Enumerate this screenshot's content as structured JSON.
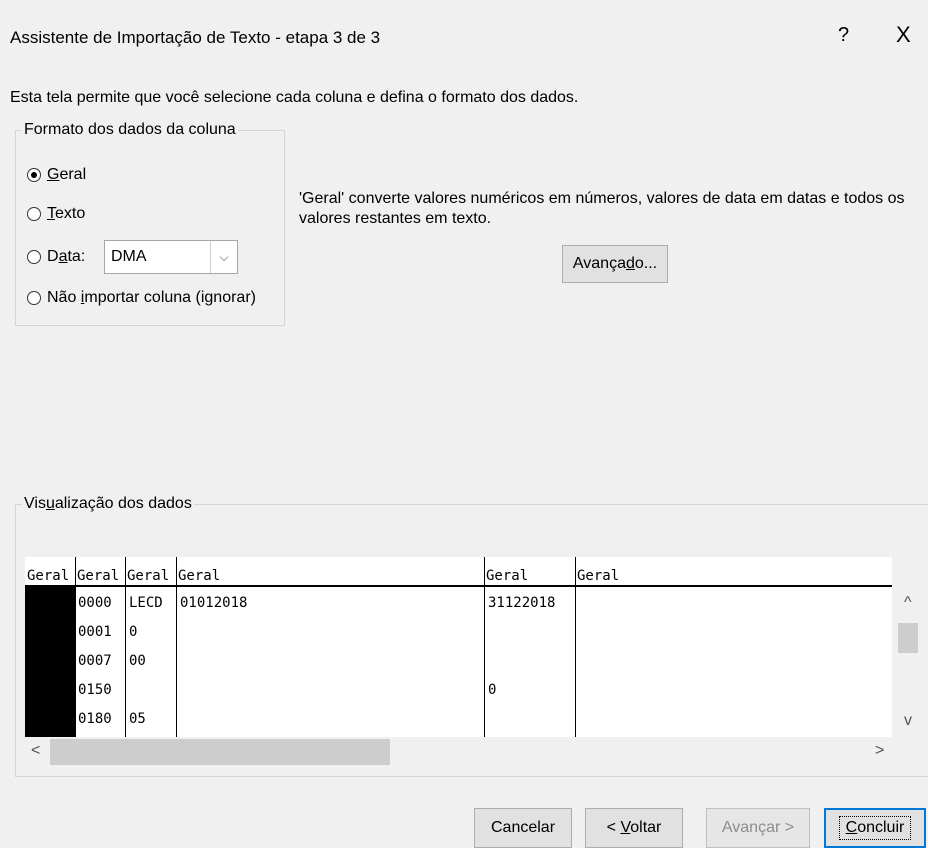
{
  "window": {
    "title": "Assistente de Importação de Texto - etapa 3 de 3",
    "help_icon": "?",
    "close_icon": "X"
  },
  "description": "Esta tela permite que você selecione cada coluna e defina o formato dos dados.",
  "column_format": {
    "legend": "Formato dos dados da coluna",
    "options": [
      {
        "pre": "",
        "u": "G",
        "post": "eral",
        "checked": true
      },
      {
        "pre": "",
        "u": "T",
        "post": "exto",
        "checked": false
      },
      {
        "pre": "D",
        "u": "a",
        "post": "ta:",
        "checked": false
      },
      {
        "pre": "Não ",
        "u": "i",
        "post": "mportar coluna (ignorar)",
        "checked": false
      }
    ],
    "date_select": {
      "value": "DMA",
      "arrow": "⌵"
    }
  },
  "explanation": "'Geral' converte valores numéricos em números, valores de data em datas e todos os valores restantes em texto.",
  "advanced_button": {
    "pre": "Avança",
    "u": "d",
    "post": "o..."
  },
  "preview": {
    "legend_pre": "Vis",
    "legend_u": "u",
    "legend_post": "alização dos dados",
    "headers": [
      "Geral",
      "Geral",
      "Geral",
      "Geral",
      "Geral",
      "Geral"
    ],
    "rows": [
      [
        "",
        "0000",
        "LECD",
        "01012018",
        "31122018",
        ""
      ],
      [
        "",
        "0001",
        "0",
        "",
        "",
        ""
      ],
      [
        "",
        "0007",
        "00",
        "",
        "",
        ""
      ],
      [
        "",
        "0150",
        "",
        "",
        "0",
        ""
      ],
      [
        "",
        "0180",
        "05",
        "",
        "",
        ""
      ]
    ]
  },
  "scroll": {
    "up": "^",
    "down": "v",
    "left": "<",
    "right": ">"
  },
  "buttons": {
    "cancel": "Cancelar",
    "back": {
      "pre": "< ",
      "u": "V",
      "post": "oltar"
    },
    "next": "Avançar >",
    "finish": {
      "pre": "",
      "u": "C",
      "post": "oncluir"
    }
  }
}
